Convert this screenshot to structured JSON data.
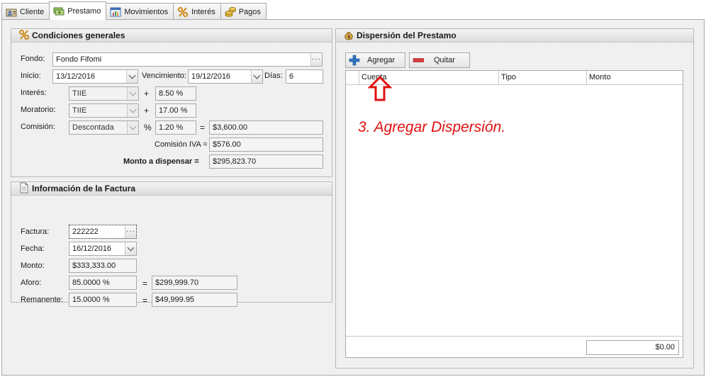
{
  "tabs": [
    {
      "label": "Cliente",
      "icon": "user-card-icon",
      "active": false
    },
    {
      "label": "Prestamo",
      "icon": "money-stack-icon",
      "active": true
    },
    {
      "label": "Movimientos",
      "icon": "chart-window-icon",
      "active": false
    },
    {
      "label": "Interés",
      "icon": "percent-icon",
      "active": false
    },
    {
      "label": "Pagos",
      "icon": "coins-icon",
      "active": false
    }
  ],
  "condiciones": {
    "title": "Condiciones generales",
    "fondo_label": "Fondo:",
    "fondo_value": "Fondo Fifomi",
    "inicio_label": "Inicio:",
    "inicio_value": "13/12/2016",
    "vencimiento_label": "Vencimiento:",
    "vencimiento_value": "19/12/2016",
    "dias_label": "Días:",
    "dias_value": "6",
    "interes_label": "Interés:",
    "interes_tipo": "TIIE",
    "interes_op": "+",
    "interes_value": "8.50 %",
    "moratorio_label": "Moratorio:",
    "moratorio_tipo": "TIIE",
    "moratorio_op": "+",
    "moratorio_value": "17.00 %",
    "comision_label": "Comisión:",
    "comision_tipo": "Descontada",
    "comision_pct_sym": "%",
    "comision_pct": "1.20 %",
    "comision_eq": "=",
    "comision_monto": "$3,600.00",
    "comision_iva_label": "Comisión IVA =",
    "comision_iva_value": "$576.00",
    "monto_label": "Monto a dispensar =",
    "monto_value": "$295,823.70"
  },
  "factura": {
    "title": "Información de la Factura",
    "factura_label": "Factura:",
    "factura_value": "222222",
    "fecha_label": "Fecha:",
    "fecha_value": "16/12/2016",
    "monto_label": "Monto:",
    "monto_value": "$333,333.00",
    "aforo_label": "Aforo:",
    "aforo_pct": "85.0000 %",
    "aforo_eq": "=",
    "aforo_value": "$299,999.70",
    "remanente_label": "Remanente:",
    "remanente_pct": "15.0000 %",
    "remanente_eq": "=",
    "remanente_value": "$49,999.95"
  },
  "dispersion": {
    "title": "Dispersión del Prestamo",
    "agregar_label": "Agregar",
    "quitar_label": "Quitar",
    "columns": [
      "Cuenta",
      "Tipo",
      "Monto"
    ],
    "total": "$0.00"
  },
  "annotation": "3. Agregar Dispersión.",
  "colors": {
    "annotation": "#e01010",
    "agregar_icon": "#2f78c8",
    "quitar_icon": "#d83a3a"
  }
}
